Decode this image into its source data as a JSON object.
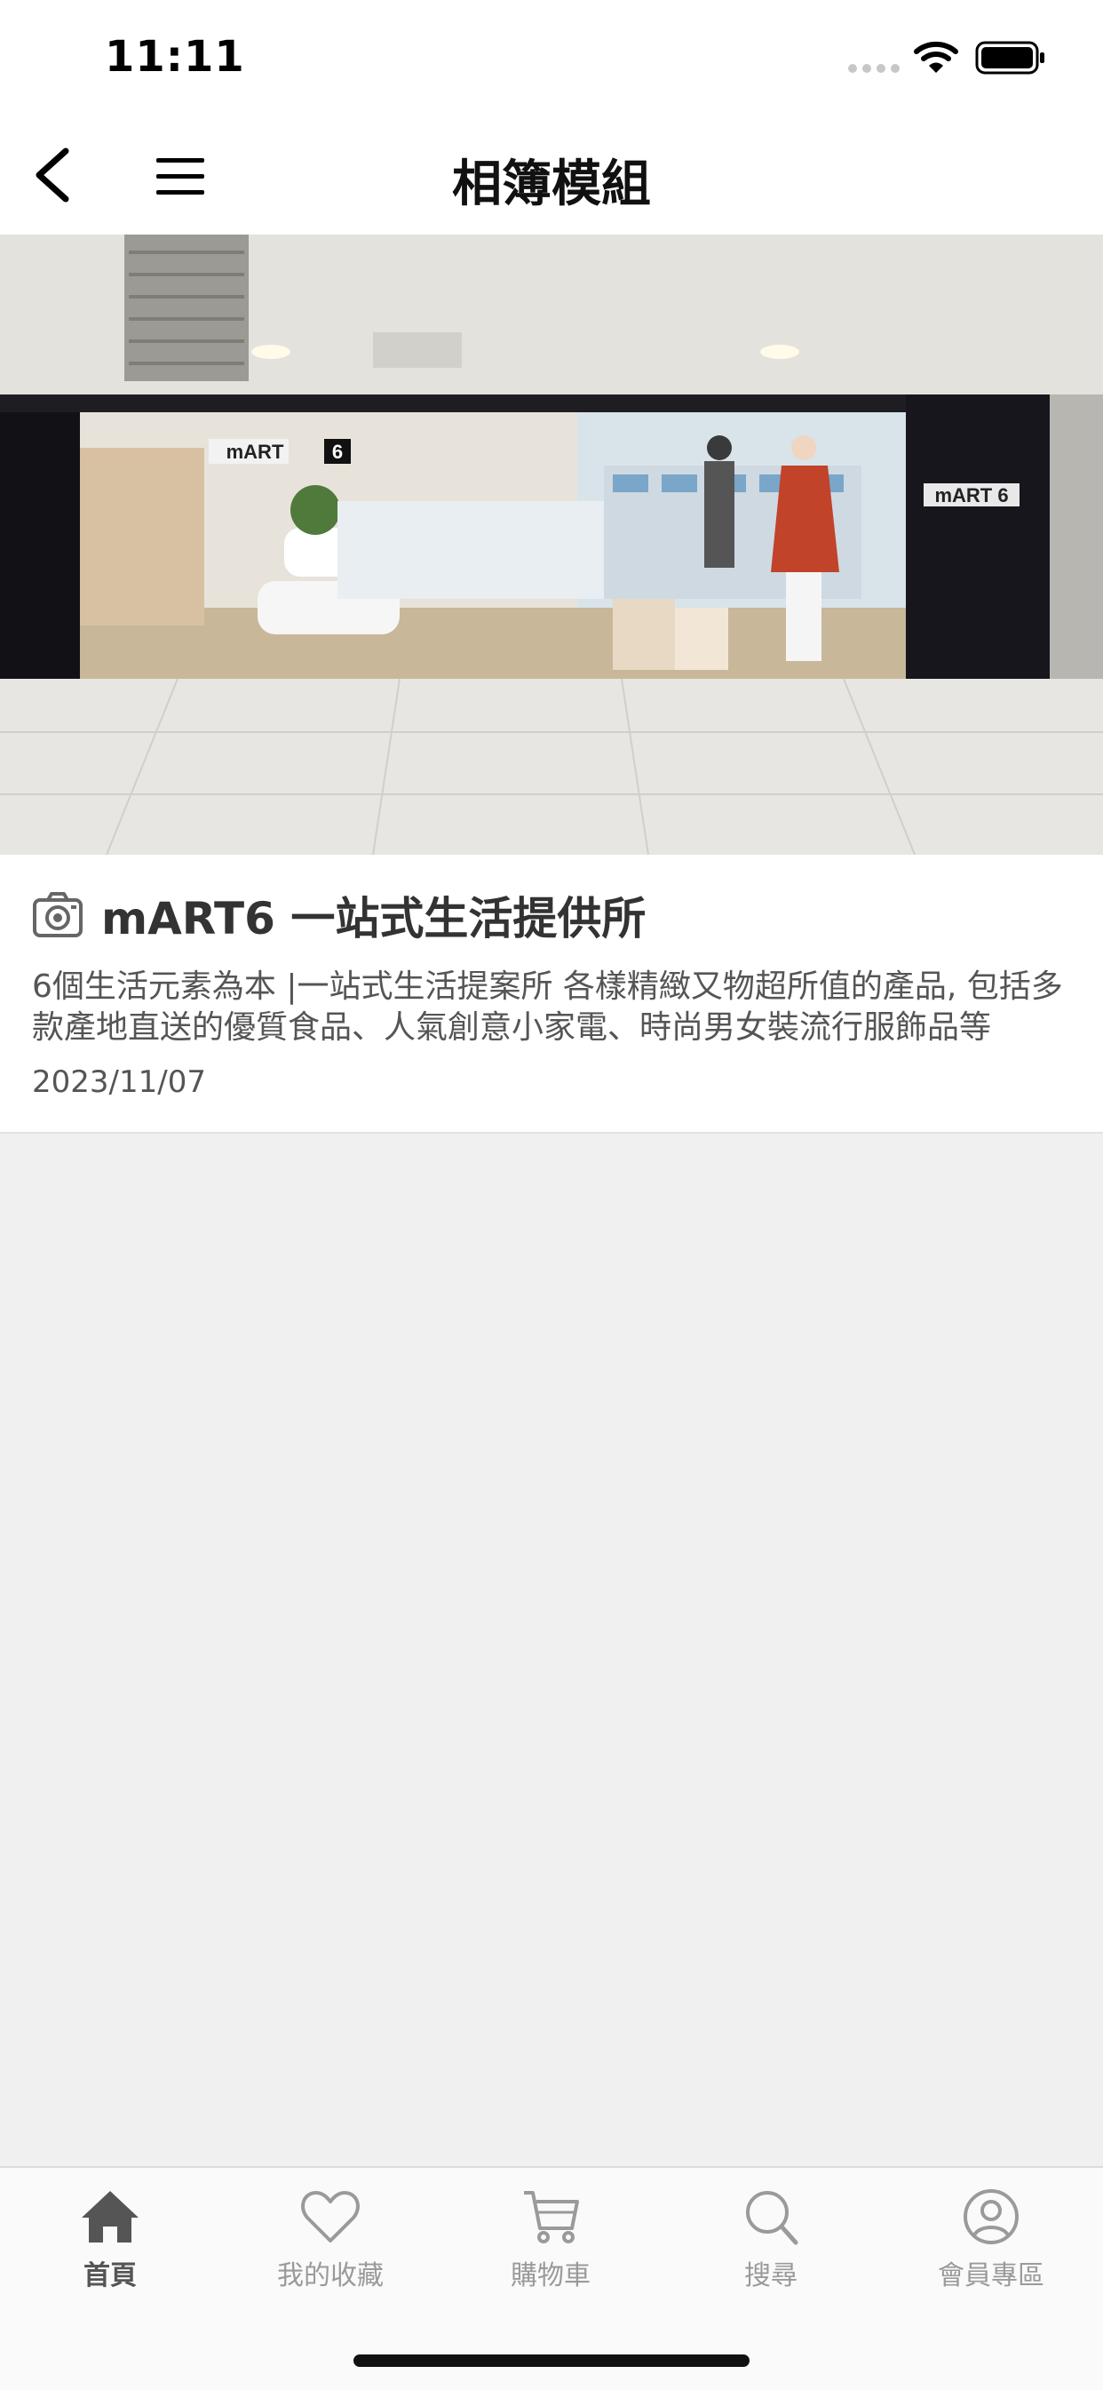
{
  "status_bar": {
    "time": "11:11"
  },
  "nav": {
    "title": "相簿模組"
  },
  "album": {
    "title": "mART6 一站式生活提供所",
    "description": "6個生活元素為本 |一站式生活提案所 各樣精緻又物超所值的產品, 包括多款產地直送的優質食品、人氣創意小家電、時尚男女裝流行服飾品等",
    "date": "2023/11/07",
    "photo_icon": "storefront-photo"
  },
  "tabs": [
    {
      "label": "首頁",
      "icon": "home-icon",
      "active": true
    },
    {
      "label": "我的收藏",
      "icon": "heart-icon",
      "active": false
    },
    {
      "label": "購物車",
      "icon": "cart-icon",
      "active": false
    },
    {
      "label": "搜尋",
      "icon": "search-icon",
      "active": false
    },
    {
      "label": "會員專區",
      "icon": "user-icon",
      "active": false
    }
  ],
  "colors": {
    "active_tab": "#555555",
    "inactive_tab": "#9a9a9a",
    "background": "#f0f0f0"
  }
}
